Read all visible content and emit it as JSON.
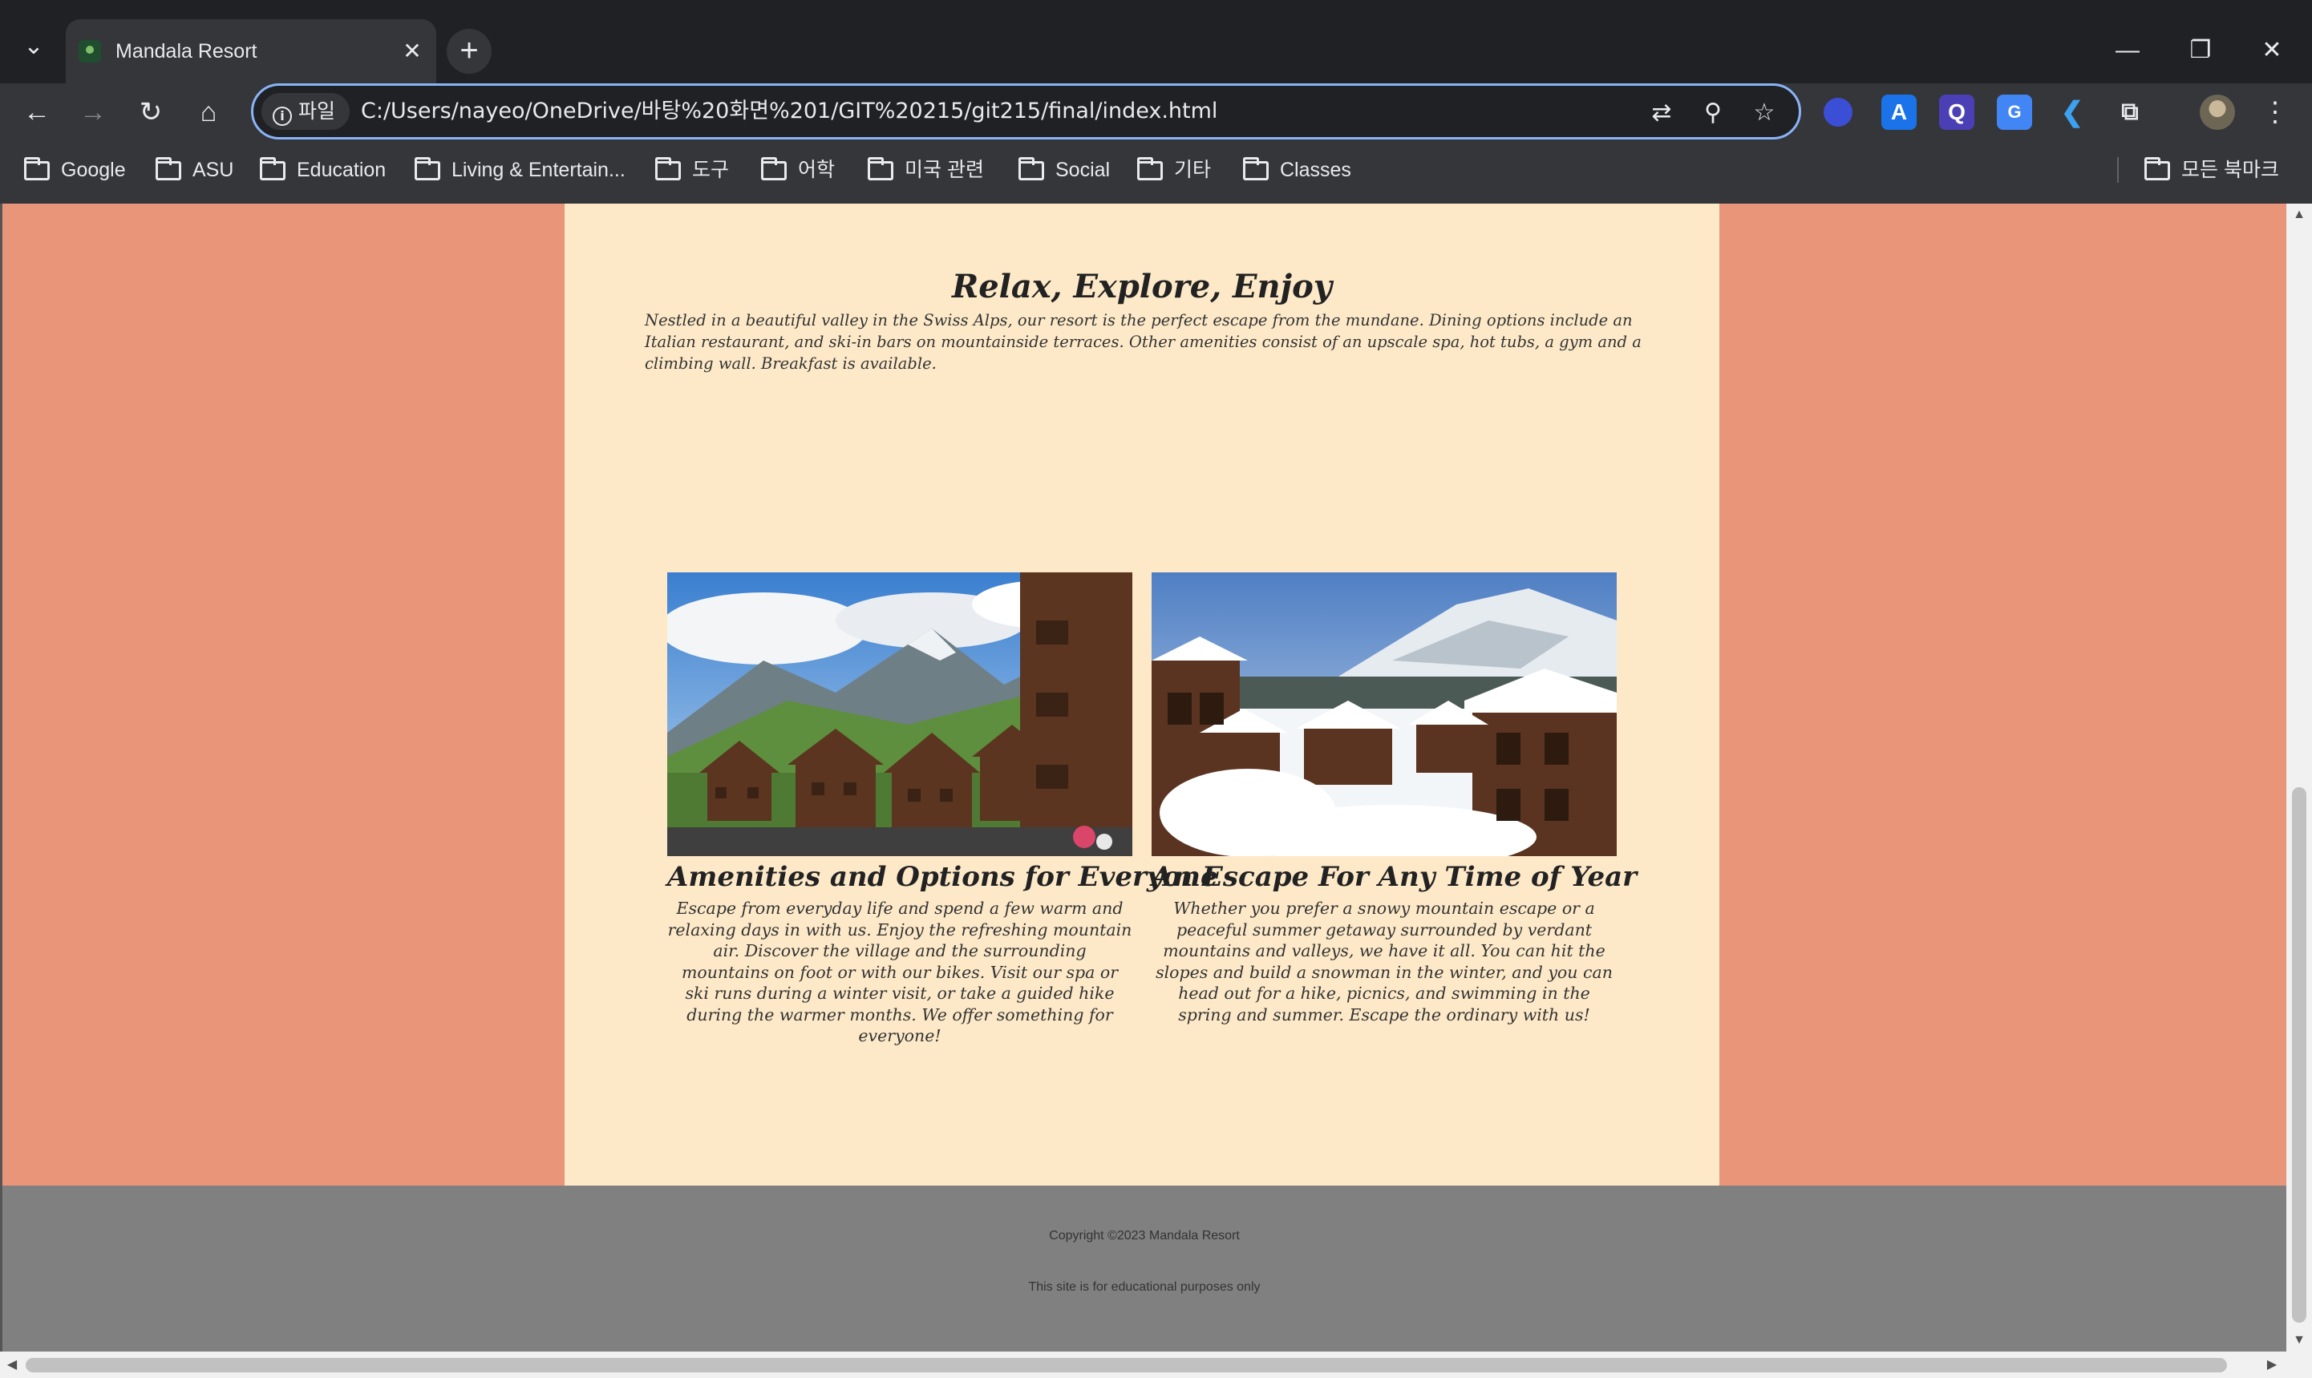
{
  "browser": {
    "tab_title": "Mandala Resort",
    "site_chip_label": "파일",
    "url": "C:/Users/nayeo/OneDrive/바탕%20화면%201/GIT%20215/git215/final/index.html",
    "icons": {
      "tab_list": "chevron-down-icon",
      "tab_close": "close-icon",
      "new_tab": "plus-icon",
      "minimize": "minimize-icon",
      "restore": "restore-icon",
      "close_window": "close-icon",
      "back": "arrow-left-icon",
      "forward": "arrow-right-icon",
      "reload": "reload-icon",
      "home": "home-icon",
      "translate": "translate-icon",
      "zoom": "zoom-icon",
      "bookmark": "star-icon",
      "menu": "kebab-menu-icon"
    },
    "extension_labels": [
      "A",
      "Q",
      "G"
    ],
    "bookmarks": [
      "Google",
      "ASU",
      "Education",
      "Living & Entertain...",
      "도구",
      "어학",
      "미국 관련",
      "Social",
      "기타",
      "Classes"
    ],
    "all_bookmarks_label": "모든 북마크"
  },
  "page": {
    "colors": {
      "outer_background": "#e8957a",
      "content_background": "#fde9c8",
      "footer_background": "#808080"
    },
    "intro": {
      "title": "Relax, Explore, Enjoy",
      "text": "Nestled in a beautiful valley in the Swiss Alps, our resort is the perfect escape from the mundane. Dining options include an Italian restaurant, and ski-in bars on mountainside terraces. Other amenities consist of an upscale spa, hot tubs, a gym and a climbing wall. Breakfast is available."
    },
    "cards": [
      {
        "title": "Amenities and Options for Everyone",
        "text": "Escape from everyday life and spend a few warm and relaxing days in with us. Enjoy the refreshing mountain air. Discover the village and the surrounding mountains on foot or with our bikes. Visit our spa or ski runs during a winter visit, or take a guided hike during the warmer months. We offer something for everyone!"
      },
      {
        "title": "An Escape For Any Time of Year",
        "text": "Whether you prefer a snowy mountain escape or a peaceful summer getaway surrounded by verdant mountains and valleys, we have it all. You can hit the slopes and build a snowman in the winter, and you can head out for a hike, picnics, and swimming in the spring and summer. Escape the ordinary with us!"
      }
    ],
    "footer": {
      "copyright": "Copyright ©2023 Mandala Resort",
      "disclaimer": "This site is for educational purposes only"
    }
  }
}
